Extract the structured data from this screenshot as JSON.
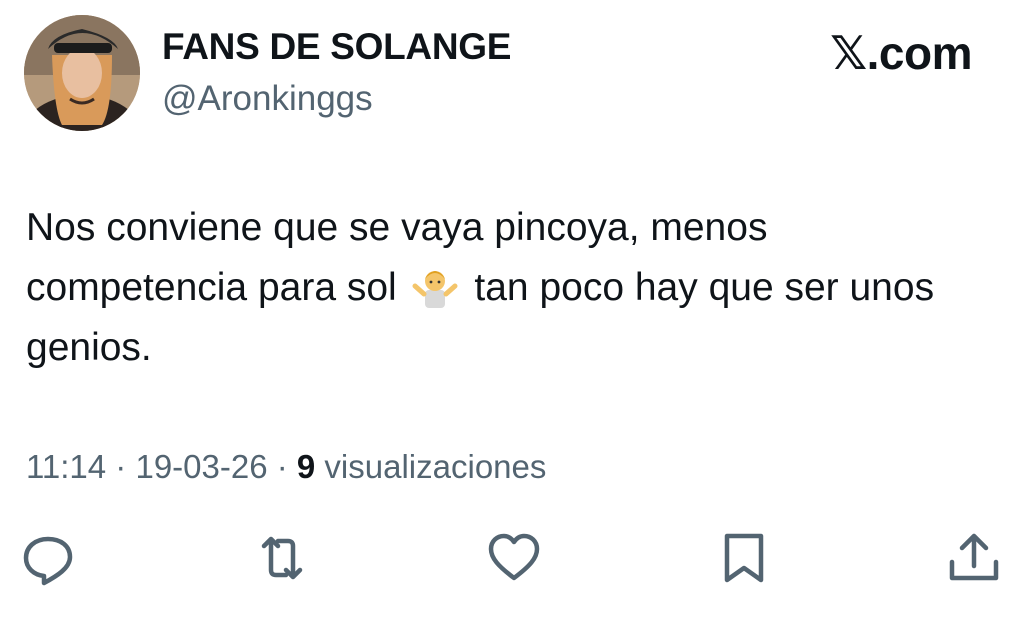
{
  "author": {
    "display_name": "FANS DE SOLANGE",
    "handle": "@Aronkinggs"
  },
  "brand": "𝕏.com",
  "tweet": {
    "text_part1": "Nos conviene que se vaya pincoya, menos competencia para sol",
    "emoji": "person-shrugging-emoji",
    "text_part2": "tan poco hay que ser unos genios."
  },
  "meta": {
    "time": "11:14",
    "separator1": " · ",
    "date": "19-03-26",
    "separator2": " · ",
    "views_count": "9",
    "views_label": " visualizaciones"
  },
  "actions": [
    {
      "icon": "reply-icon"
    },
    {
      "icon": "retweet-icon"
    },
    {
      "icon": "like-icon"
    },
    {
      "icon": "bookmark-icon"
    },
    {
      "icon": "share-icon"
    }
  ],
  "colors": {
    "text_primary": "#0f1419",
    "text_secondary": "#536471"
  }
}
